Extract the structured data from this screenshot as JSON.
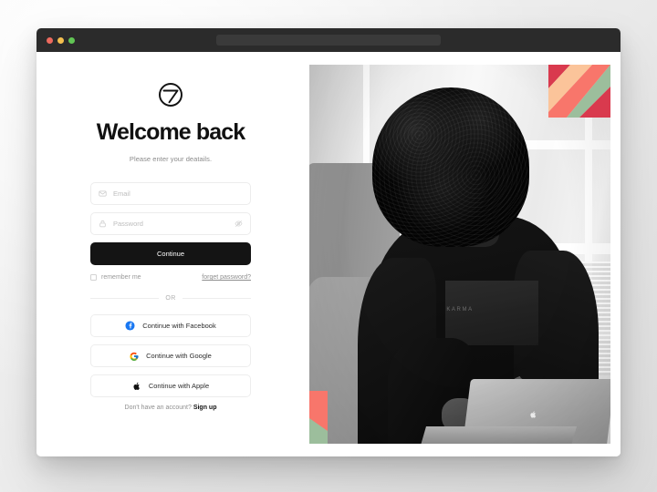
{
  "window": {
    "traffic_lights": [
      "close",
      "minimize",
      "maximize"
    ],
    "address_value": ""
  },
  "brand": {
    "logo_icon": "circle-seven-logo"
  },
  "form": {
    "heading": "Welcome back",
    "subheading": "Please enter your deatails.",
    "email": {
      "placeholder": "Email",
      "value": "",
      "icon": "envelope-icon"
    },
    "password": {
      "placeholder": "Password",
      "value": "",
      "icon": "lock-icon",
      "toggle_icon": "eye-slash-icon"
    },
    "submit_label": "Continue",
    "remember_label": "remember me",
    "remember_checked": false,
    "forgot_label": "forget password?",
    "divider_label": "OR",
    "social_buttons": [
      {
        "label": "Continue with Facebook",
        "icon": "facebook-icon",
        "color": "#1877F2"
      },
      {
        "label": "Continue with Google",
        "icon": "google-icon",
        "color": "#4285F4"
      },
      {
        "label": "Continue with Apple",
        "icon": "apple-icon",
        "color": "#111111"
      }
    ],
    "signup_prompt": "Don't have an account?",
    "signup_link": "Sign up"
  },
  "photo": {
    "alt": "Woman with curly hair working on a MacBook by an office window, black and white",
    "shirt_text": "KARMA",
    "decor_colors": {
      "crimson": "#D93A4E",
      "peach": "#FBC49A",
      "salmon": "#F8766B",
      "sage": "#9CBE9C"
    }
  }
}
